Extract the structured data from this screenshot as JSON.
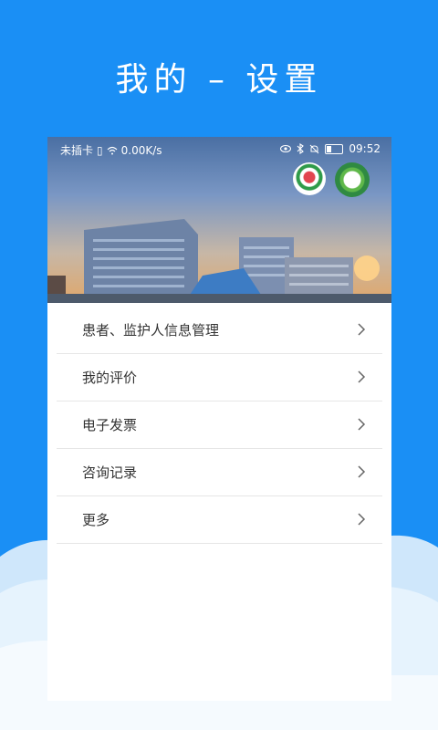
{
  "promo": {
    "title": "我的 – 设置"
  },
  "statusbar": {
    "carrier": "未插卡",
    "speed": "0.00K/s",
    "time": "09:52"
  },
  "menu": {
    "items": [
      {
        "label": "患者、监护人信息管理"
      },
      {
        "label": "我的评价"
      },
      {
        "label": "电子发票"
      },
      {
        "label": "咨询记录"
      },
      {
        "label": "更多"
      }
    ]
  },
  "colors": {
    "background": "#1a8ff5",
    "panel": "#ffffff",
    "text": "#333333",
    "divider": "#e6e6e6"
  },
  "icons": [
    "sim-icon",
    "wifi-icon",
    "eye-icon",
    "bluetooth-icon",
    "mute-icon",
    "battery-icon",
    "chevron-right-icon"
  ]
}
